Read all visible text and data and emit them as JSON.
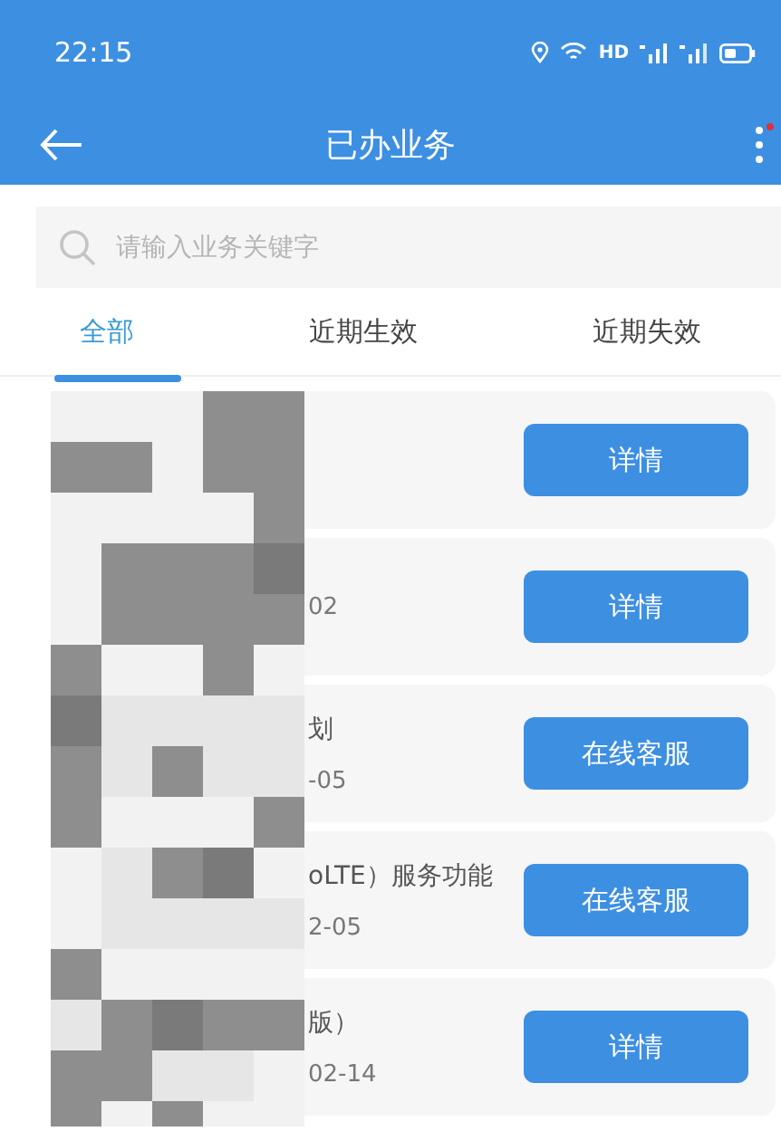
{
  "status_bar": {
    "time": "22:15",
    "network_label": "HD"
  },
  "header": {
    "title": "已办业务"
  },
  "search": {
    "placeholder": "请输入业务关键字"
  },
  "tabs": [
    {
      "label": "全部",
      "selected": true
    },
    {
      "label": "近期生效",
      "selected": false
    },
    {
      "label": "近期失效",
      "selected": false
    }
  ],
  "items": [
    {
      "button": "详情"
    },
    {
      "date": "02",
      "button": "详情"
    },
    {
      "title": "划",
      "date": "-05",
      "button": "在线客服"
    },
    {
      "title": "oLTE）服务功能",
      "date": "2-05",
      "button": "在线客服"
    },
    {
      "title": "版）",
      "date": "02-14",
      "button": "详情"
    }
  ]
}
